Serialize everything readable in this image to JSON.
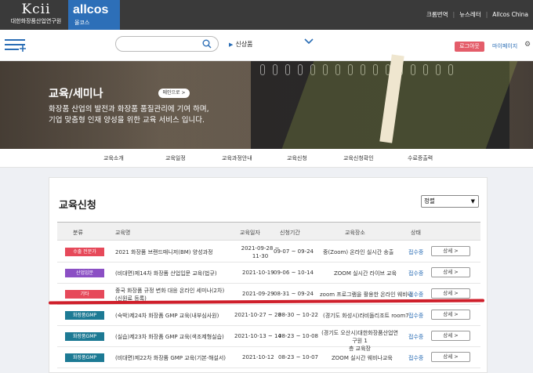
{
  "top": {
    "kcii_logo": "Kcii",
    "kcii_name": "대한화장품산업연구원",
    "allcos_logo": "allcos",
    "allcos_name": "올코스",
    "links": [
      "크롬번역",
      "뉴스레터",
      "Allcos China"
    ]
  },
  "nav": {
    "search_placeholder": "",
    "category": "신상품",
    "logout": "로그아웃",
    "mypage": "마이페이지"
  },
  "banner": {
    "title": "교육/세미나",
    "button": "메인으로 >",
    "line1": "화장품 산업의 발전과 화장품 품질관리에 기여 하며,",
    "line2": "기업 맞춤형 인재 양성을 위한 교육 서비스 입니다."
  },
  "subnav": [
    "교육소개",
    "교육일정",
    "교육과정안내",
    "교육신청",
    "교육신청확인",
    "수료증출력"
  ],
  "content": {
    "title": "교육신청",
    "sort": "정렬",
    "headers": [
      "분류",
      "교육명",
      "교육일자",
      "신청기간",
      "교육장소",
      "상태"
    ],
    "rows": [
      {
        "badge": "수출 전문가",
        "color": "#e6495a",
        "name": "2021 화장품 브랜드매니저(BM) 양성과정",
        "date1": "2021-09-28 ~",
        "date2": "11-30",
        "period": "09-07 ~ 09-24",
        "place": "중(Zoom) 온라인 실시간 송출",
        "status": "접수중",
        "detail": "상세 >"
      },
      {
        "badge": "산업입문",
        "color": "#8b4fc4",
        "name": "(비대면)제14차 화장품 산업입문 교육(법규)",
        "date1": "2021-10-19",
        "date2": "",
        "period": "09-06 ~ 10-14",
        "place": "ZOOM 실시간 라이브 교육",
        "status": "접수중",
        "detail": "상세 >"
      },
      {
        "badge": "기타",
        "color": "#e6495a",
        "name": "중국 화장품 규정 변화 대응 온라인 세미나(2차)",
        "name2": "(신원료 등록)",
        "date1": "2021-09-29",
        "date2": "",
        "period": "08-31 ~ 09-24",
        "place": "zoom 프로그램을 활용한 온라인 웨비나",
        "status": "접수중",
        "detail": "상세 >"
      },
      {
        "badge": "화장품GMP",
        "color": "#1d7a94",
        "name": "(숙박)제24차 화장품 GMP 교육(내부심사원)",
        "date1": "2021-10-27 ~ 28",
        "date2": "",
        "period": "08-30 ~ 10-22",
        "place": "(경기도 화성시)라비돌리조트 room7",
        "status": "접수중",
        "detail": "상세 >"
      },
      {
        "badge": "화장품GMP",
        "color": "#1d7a94",
        "name": "(실습)제23차 화장품 GMP 교육(색조제형실습)",
        "date1": "2021-10-13 ~ 14",
        "date2": "",
        "period": "08-23 ~ 10-08",
        "place": "(경기도 오산시)대한화장품산업연구원 1",
        "place2": "층 교육장",
        "status": "접수중",
        "detail": "상세 >"
      },
      {
        "badge": "화장품GMP",
        "color": "#1d7a94",
        "name": "(비대면)제22차 화장품 GMP 교육(기본·해설서)",
        "date1": "2021-10-12",
        "date2": "",
        "period": "08-23 ~ 10-07",
        "place": "ZOOM 실시간 웨비나교육",
        "status": "접수중",
        "detail": "상세 >"
      }
    ]
  }
}
